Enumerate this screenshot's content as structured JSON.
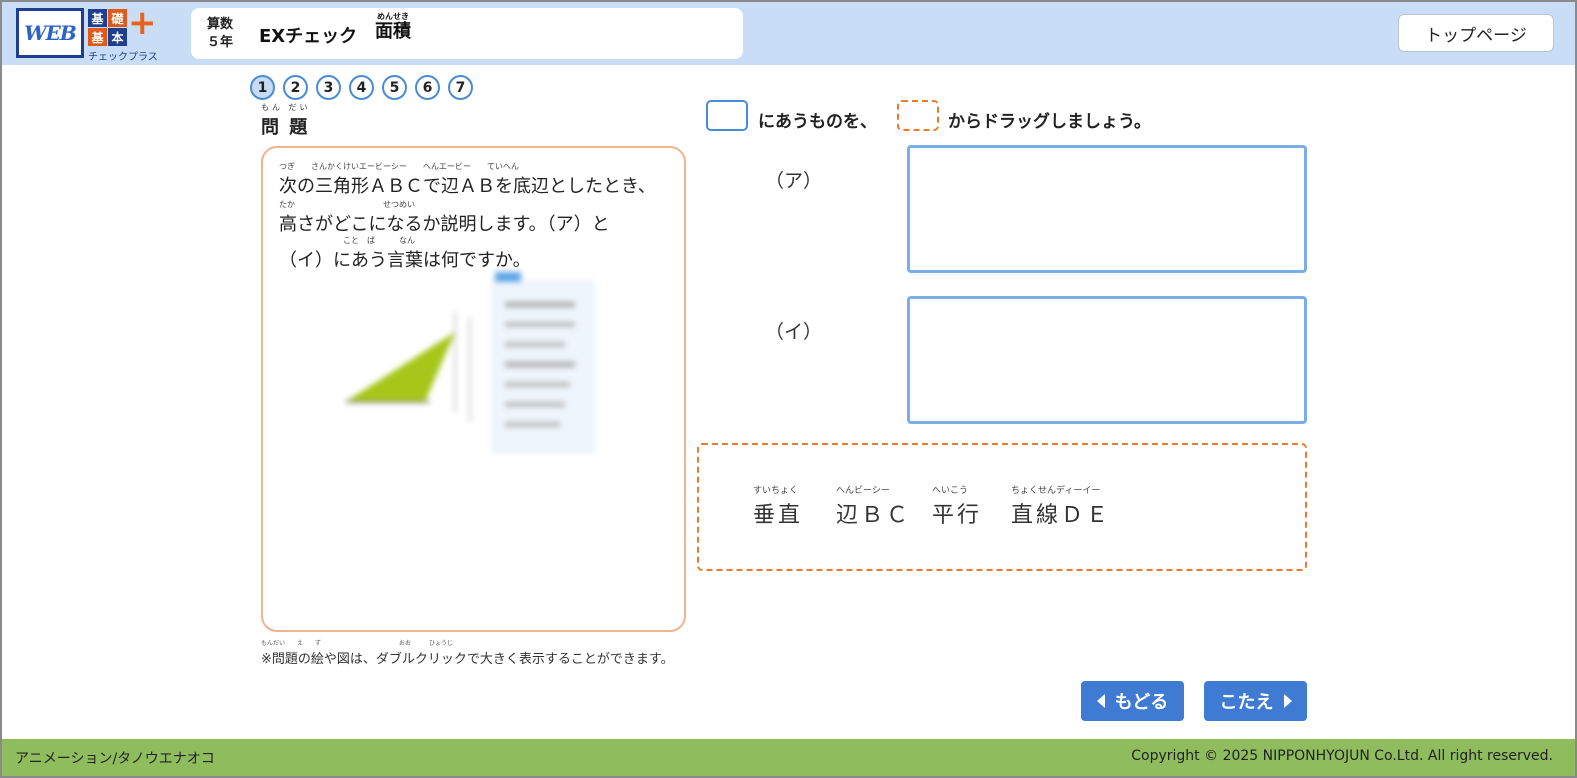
{
  "header": {
    "logo_web": "WEB",
    "logo_blocks": [
      "基",
      "礎",
      "基",
      "本"
    ],
    "logo_plus": "+",
    "logo_sub": "チェックプラス",
    "subject_line1": "算数",
    "subject_line2": "５年",
    "title": "EXチェック",
    "topic_ruby": "めんせき",
    "topic": "面積",
    "top_button": "トップページ"
  },
  "steps": [
    "1",
    "2",
    "3",
    "4",
    "5",
    "6",
    "7"
  ],
  "question": {
    "heading_ruby": "もん だい",
    "heading": "問 題",
    "line1_ruby": "つぎ　　さんかくけいエービーシー　　へんエービー　　ていへん",
    "line1": "次の三角形ＡＢＣで辺ＡＢを底辺としたとき、",
    "line2_ruby": "たか　　　　　　　　　　　せつめい",
    "line2": "高さがどこになるか説明します。（ア）と",
    "line3_ruby": "　　　　　　　　こと　ば　　　なん",
    "line3": "（イ）にあう言葉は何ですか。",
    "note_ruby": "もんだい　　え　　ず　　　　　　　　　　　　　おお　　　ひょうじ",
    "note": "※問題の絵や図は、ダブルクリックで大きく表示することができます。"
  },
  "instruction": {
    "part1": "にあうものを、",
    "part2": "からドラッグしましょう。"
  },
  "answers": {
    "a_label": "（ア）",
    "b_label": "（イ）"
  },
  "choices": [
    {
      "ruby": "すいちょく",
      "text": "垂直"
    },
    {
      "ruby": "へんビーシー",
      "text": "辺ＢＣ"
    },
    {
      "ruby": "へいこう",
      "text": "平行"
    },
    {
      "ruby": "ちょくせんディーイー",
      "text": "直線ＤＥ"
    }
  ],
  "nav": {
    "back": "もどる",
    "answer": "こたえ"
  },
  "footer": {
    "left": "アニメーション/タノウエナオコ",
    "right": "Copyright © 2025 NIPPONHYOJUN Co.Ltd. All right reserved."
  },
  "colors": {
    "header_bg": "#c9ddf7",
    "footer_bg": "#8fbd5e",
    "accent_blue": "#3f7bd2",
    "accent_orange": "#ee7b2c"
  }
}
